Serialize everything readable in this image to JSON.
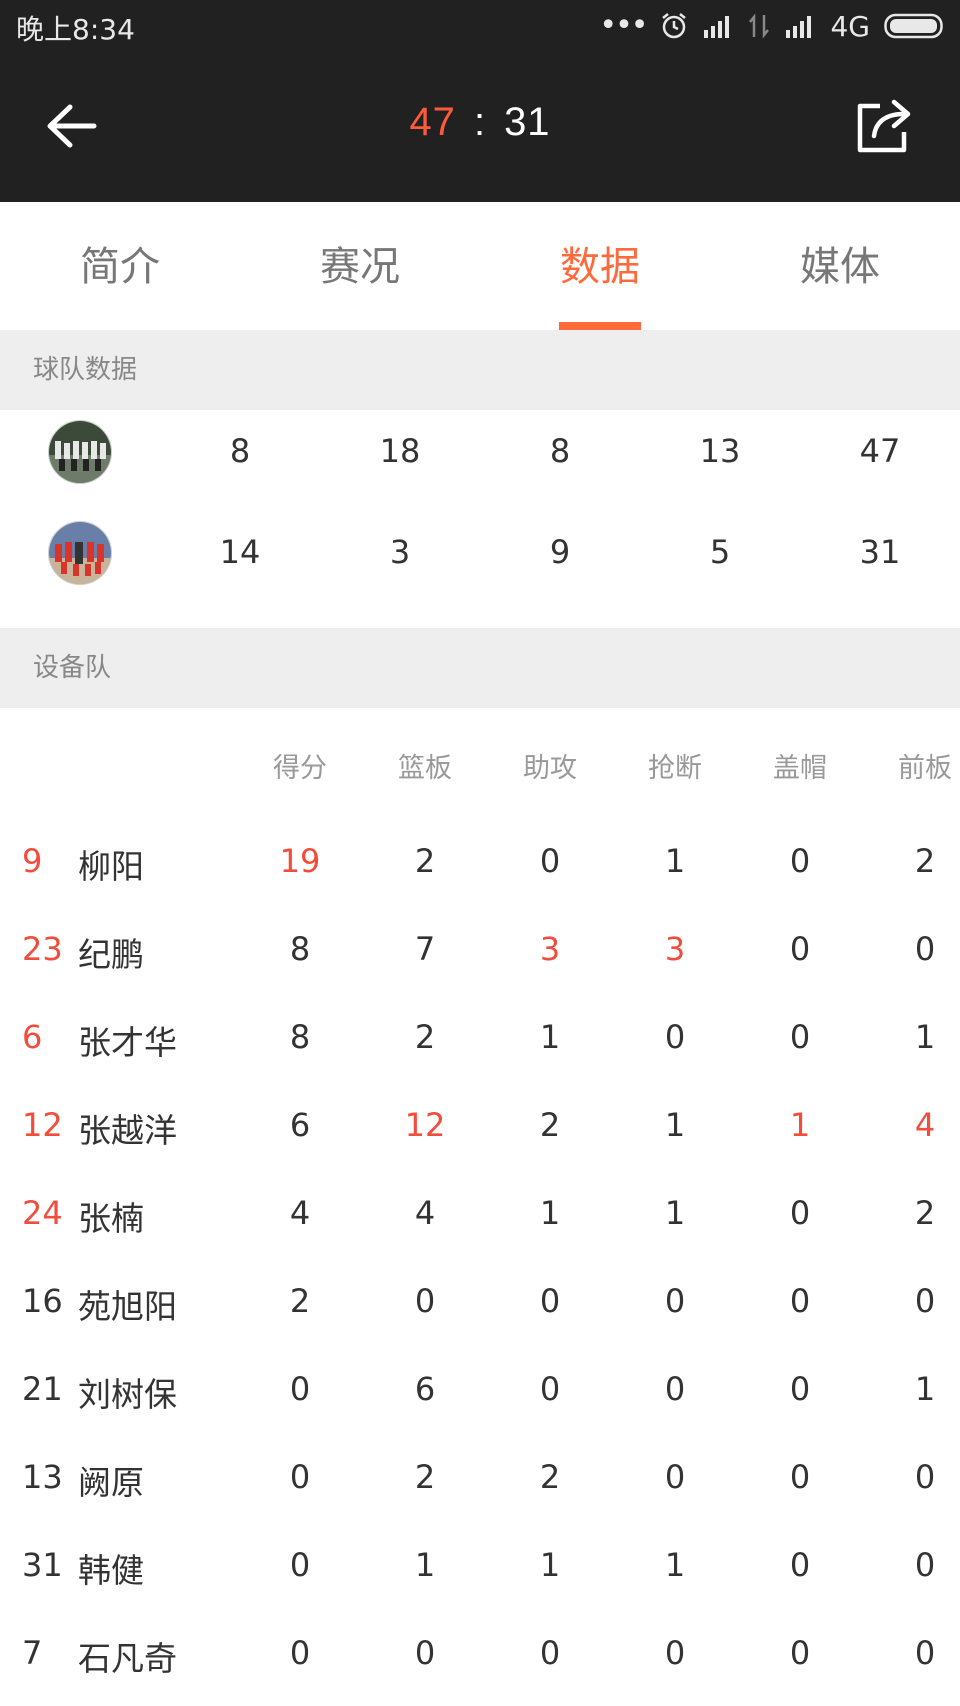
{
  "status": {
    "time": "晚上8:34",
    "network": "4G"
  },
  "header": {
    "home_score": "47",
    "separator": ":",
    "away_score": "31"
  },
  "tabs": [
    "简介",
    "赛况",
    "数据",
    "媒体"
  ],
  "active_tab": 2,
  "team_section": {
    "title": "球队数据"
  },
  "teams": [
    {
      "values": [
        "8",
        "18",
        "8",
        "13",
        "47"
      ]
    },
    {
      "values": [
        "14",
        "3",
        "9",
        "5",
        "31"
      ]
    }
  ],
  "player_section": {
    "title": "设备队"
  },
  "columns": [
    "得分",
    "篮板",
    "助攻",
    "抢断",
    "盖帽",
    "前板"
  ],
  "players": [
    {
      "number": "9",
      "number_hl": true,
      "name": "柳阳",
      "stats": [
        "19",
        "2",
        "0",
        "1",
        "0",
        "2"
      ],
      "hl": [
        true,
        false,
        false,
        false,
        false,
        false
      ]
    },
    {
      "number": "23",
      "number_hl": true,
      "name": "纪鹏",
      "stats": [
        "8",
        "7",
        "3",
        "3",
        "0",
        "0"
      ],
      "hl": [
        false,
        false,
        true,
        true,
        false,
        false
      ]
    },
    {
      "number": "6",
      "number_hl": true,
      "name": "张才华",
      "stats": [
        "8",
        "2",
        "1",
        "0",
        "0",
        "1"
      ],
      "hl": [
        false,
        false,
        false,
        false,
        false,
        false
      ]
    },
    {
      "number": "12",
      "number_hl": true,
      "name": "张越洋",
      "stats": [
        "6",
        "12",
        "2",
        "1",
        "1",
        "4"
      ],
      "hl": [
        false,
        true,
        false,
        false,
        true,
        true
      ]
    },
    {
      "number": "24",
      "number_hl": true,
      "name": "张楠",
      "stats": [
        "4",
        "4",
        "1",
        "1",
        "0",
        "2"
      ],
      "hl": [
        false,
        false,
        false,
        false,
        false,
        false
      ]
    },
    {
      "number": "16",
      "number_hl": false,
      "name": "苑旭阳",
      "stats": [
        "2",
        "0",
        "0",
        "0",
        "0",
        "0"
      ],
      "hl": [
        false,
        false,
        false,
        false,
        false,
        false
      ]
    },
    {
      "number": "21",
      "number_hl": false,
      "name": "刘树保",
      "stats": [
        "0",
        "6",
        "0",
        "0",
        "0",
        "1"
      ],
      "hl": [
        false,
        false,
        false,
        false,
        false,
        false
      ]
    },
    {
      "number": "13",
      "number_hl": false,
      "name": "阙原",
      "stats": [
        "0",
        "2",
        "2",
        "0",
        "0",
        "0"
      ],
      "hl": [
        false,
        false,
        false,
        false,
        false,
        false
      ]
    },
    {
      "number": "31",
      "number_hl": false,
      "name": "韩健",
      "stats": [
        "0",
        "1",
        "1",
        "1",
        "0",
        "0"
      ],
      "hl": [
        false,
        false,
        false,
        false,
        false,
        false
      ]
    },
    {
      "number": "7",
      "number_hl": false,
      "name": "石凡奇",
      "stats": [
        "0",
        "0",
        "0",
        "0",
        "0",
        "0"
      ],
      "hl": [
        false,
        false,
        false,
        false,
        false,
        false
      ]
    }
  ],
  "colors": {
    "accent": "#ff6a3d",
    "highlight": "#f24c3c",
    "topbar": "#212121"
  }
}
